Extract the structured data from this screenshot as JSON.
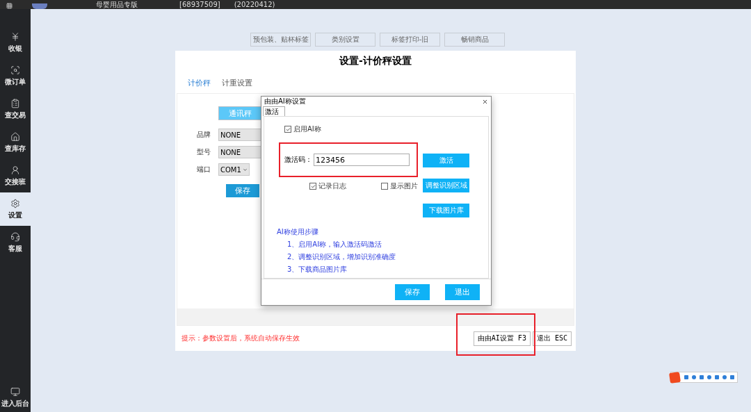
{
  "top_bar": {
    "edition": "母婴用品专版",
    "account": "[68937509]",
    "version": "(20220412)"
  },
  "sidebar": {
    "items": [
      {
        "label": "收银",
        "selected": false
      },
      {
        "label": "微订单",
        "selected": false
      },
      {
        "label": "查交易",
        "selected": false
      },
      {
        "label": "查库存",
        "selected": false
      },
      {
        "label": "交接班",
        "selected": false
      },
      {
        "label": "设置",
        "selected": true
      },
      {
        "label": "客服",
        "selected": false
      }
    ],
    "footer": "进入后台"
  },
  "quick_buttons": [
    "预包装、贴杯标签",
    "类别设置",
    "标签打印-旧",
    "畅销商品"
  ],
  "settings_panel": {
    "title": "设置-计价秤设置",
    "tabs": [
      {
        "label": "计价秤",
        "selected": true
      },
      {
        "label": "计重设置",
        "selected": false
      }
    ],
    "scale_button": "通讯秤",
    "fields": [
      {
        "label": "品牌",
        "value": "NONE",
        "kind": "text"
      },
      {
        "label": "型号",
        "value": "NONE",
        "kind": "text"
      },
      {
        "label": "端口",
        "value": "COM1",
        "kind": "select"
      }
    ],
    "save": "保存",
    "hint": "提示：参数设置后，系统自动保存生效",
    "buttons": [
      {
        "label": "由由AI设置 F3",
        "highlighted": true
      },
      {
        "label": "退出 ESC",
        "highlighted": false
      }
    ]
  },
  "dialog": {
    "title": "由由AI称设置",
    "tabs": [
      {
        "label": "激活",
        "selected": true
      }
    ],
    "enable_ai": {
      "label": "启用AI称",
      "checked": true
    },
    "code": {
      "label": "激活码：",
      "value": "123456",
      "highlighted": true
    },
    "options": [
      {
        "label": "记录日志",
        "checked": true
      },
      {
        "label": "显示图片",
        "checked": false
      }
    ],
    "actions": [
      "激活",
      "调整识别区域",
      "下载图片库"
    ],
    "steps_title": "AI称使用步骤",
    "steps": [
      "1、启用AI称，输入激活码激活",
      "2、调整识别区域，增加识别准确度",
      "3、下载商品图片库"
    ],
    "footer_buttons": [
      "保存",
      "退出"
    ]
  }
}
